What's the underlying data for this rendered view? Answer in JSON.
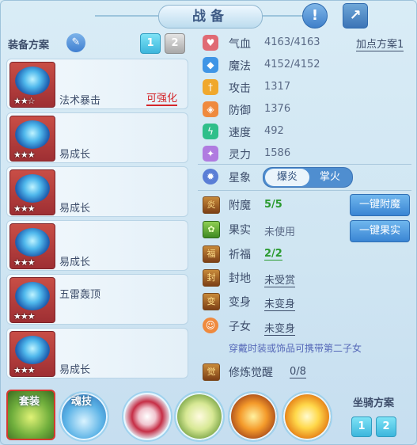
{
  "header": {
    "title": "战备",
    "help_icon": "exclamation-icon",
    "share_icon": "share-icon"
  },
  "equip_plan": {
    "label": "装备方案",
    "tabs": [
      "1",
      "2"
    ],
    "active_tab": "1",
    "items": [
      {
        "name": "法术暴击",
        "note": "可强化",
        "stars_filled": 2,
        "stars_total": 3
      },
      {
        "name": "易成长",
        "stars_filled": 3,
        "stars_total": 3
      },
      {
        "name": "易成长",
        "stars_filled": 3,
        "stars_total": 3
      },
      {
        "name": "易成长",
        "stars_filled": 3,
        "stars_total": 3
      },
      {
        "name": "五雷轰顶",
        "stars_filled": 3,
        "stars_total": 3
      },
      {
        "name": "易成长",
        "stars_filled": 3,
        "stars_total": 3
      }
    ]
  },
  "stats": [
    {
      "label": "气血",
      "value": "4163/4163",
      "icon": "heart-icon",
      "color": "#e06a74"
    },
    {
      "label": "魔法",
      "value": "4152/4152",
      "icon": "diamond-icon",
      "color": "#3f95e6"
    },
    {
      "label": "攻击",
      "value": "1317",
      "icon": "sword-icon",
      "color": "#f0a82c"
    },
    {
      "label": "防御",
      "value": "1376",
      "icon": "shield-icon",
      "color": "#ef8a3e"
    },
    {
      "label": "速度",
      "value": "492",
      "icon": "lightning-icon",
      "color": "#2fbf8a"
    },
    {
      "label": "灵力",
      "value": "1586",
      "icon": "spirit-icon",
      "color": "#b07be0"
    }
  ],
  "add_point_plan": "加点方案1",
  "star_sign": {
    "label": "星象",
    "options": [
      "爆炎",
      "掌火"
    ],
    "selected": "爆炎"
  },
  "extras": {
    "enchant": {
      "label": "附魔",
      "value": "5/5"
    },
    "fruit": {
      "label": "果实",
      "value": "未使用"
    },
    "blessing": {
      "label": "祈福",
      "value": "2/2"
    },
    "fief": {
      "label": "封地",
      "value": "未受赏"
    },
    "transform": {
      "label": "变身",
      "value": "未变身"
    },
    "children": {
      "label": "子女",
      "value": "未变身"
    },
    "awaken": {
      "label": "修炼觉醒",
      "value": "0/8"
    }
  },
  "buttons": {
    "enchant": "一键附魔",
    "fruit": "一键果实"
  },
  "hint": "穿戴时装或饰品可携带第二子女",
  "bottom": {
    "suit_label": "套装",
    "soul_label": "魂技",
    "mount_label": "坐骑方案",
    "mount_tabs": [
      "1",
      "2"
    ]
  }
}
